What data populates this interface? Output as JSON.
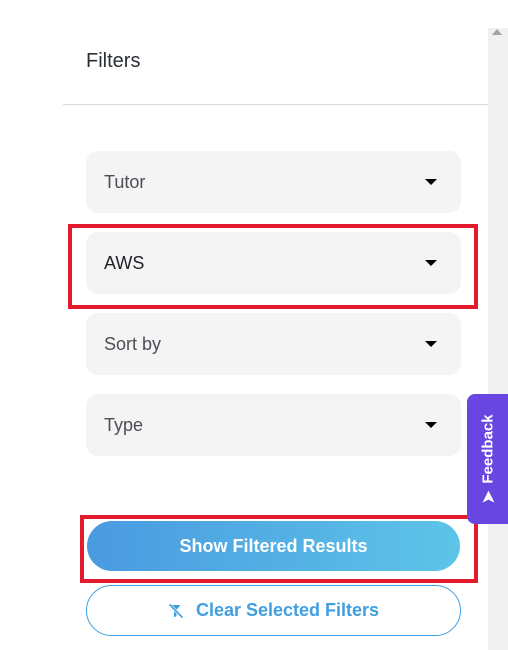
{
  "panel": {
    "title": "Filters"
  },
  "filters": {
    "tutor": {
      "value": "Tutor"
    },
    "course": {
      "value": "AWS"
    },
    "sort": {
      "value": "Sort by"
    },
    "type": {
      "value": "Type"
    }
  },
  "actions": {
    "show_label": "Show Filtered Results",
    "clear_label": "Clear Selected Filters"
  },
  "feedback": {
    "label": "Feedback"
  },
  "colors": {
    "highlight": "#e41b2c",
    "feedback_bg": "#6846e0",
    "button_gradient_start": "#4a9ae0",
    "button_gradient_end": "#5dc4e8",
    "clear_button": "#3f9fe0"
  },
  "icons": {
    "dropdown": "caret-down-icon",
    "clear": "filter-clear-icon",
    "feedback": "send-arrow-icon"
  }
}
